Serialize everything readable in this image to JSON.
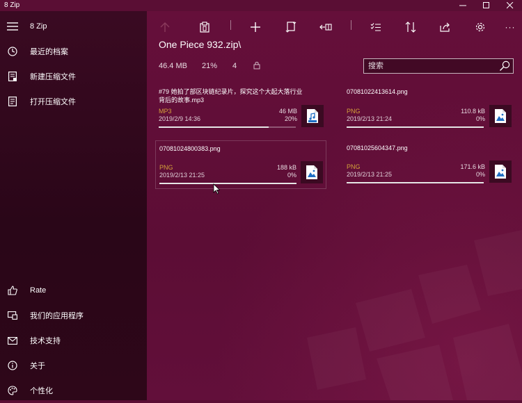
{
  "app": {
    "title": "8 Zip"
  },
  "window_controls": {
    "minimize": "minimize-icon",
    "maximize": "maximize-icon",
    "close": "close-icon"
  },
  "sidebar": {
    "menu_label": "8 Zip",
    "top_items": [
      {
        "label": "最近的档案",
        "icon": "clock-icon"
      },
      {
        "label": "新建压缩文件",
        "icon": "new-archive-icon"
      },
      {
        "label": "打开压缩文件",
        "icon": "open-archive-icon"
      }
    ],
    "bottom_items": [
      {
        "label": "Rate",
        "icon": "thumbs-up-icon"
      },
      {
        "label": "我们的应用程序",
        "icon": "apps-icon"
      },
      {
        "label": "技术支持",
        "icon": "mail-icon"
      },
      {
        "label": "关于",
        "icon": "info-icon"
      },
      {
        "label": "个性化",
        "icon": "palette-icon"
      }
    ]
  },
  "toolbar": {
    "items": [
      "up-arrow-icon",
      "paste-icon",
      "add-icon",
      "extract-icon",
      "move-icon",
      "select-all-icon",
      "sort-icon",
      "share-icon",
      "settings-icon",
      "more-icon"
    ],
    "more_label": "···"
  },
  "archive": {
    "path": "One Piece 932.zip\\",
    "size": "46.4 MB",
    "ratio": "21%",
    "count": "4",
    "lock_icon": "lock-icon"
  },
  "search": {
    "placeholder": "搜索",
    "icon": "search-icon"
  },
  "files": [
    {
      "name": "#79 她拍了部区块链纪录片，探究这个大起大落行业背后的故事.mp3",
      "type": "MP3",
      "date": "2019/2/9 14:36",
      "size": "46 MB",
      "percent": "20%",
      "progress": 0.8,
      "icon": "audio-file-icon"
    },
    {
      "name": "07081022413614.png",
      "type": "PNG",
      "date": "2019/2/13 21:24",
      "size": "110.8 kB",
      "percent": "0%",
      "progress": 1.0,
      "icon": "image-file-icon"
    },
    {
      "name": "07081024800383.png",
      "type": "PNG",
      "date": "2019/2/13 21:25",
      "size": "188 kB",
      "percent": "0%",
      "progress": 1.0,
      "icon": "image-file-icon"
    },
    {
      "name": "07081025604347.png",
      "type": "PNG",
      "date": "2019/2/13 21:25",
      "size": "171.6 kB",
      "percent": "0%",
      "progress": 1.0,
      "icon": "image-file-icon"
    }
  ],
  "colors": {
    "sidebar_bg": "#2a0618",
    "main_bg": "#5c0d35",
    "type_label": "#d4a23a"
  }
}
